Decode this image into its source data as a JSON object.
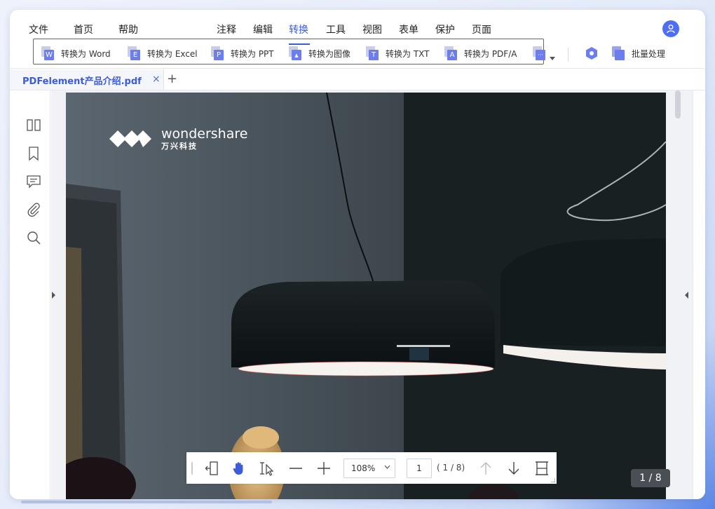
{
  "menubar": {
    "items": [
      "文件",
      "首页",
      "帮助",
      "注释",
      "编辑",
      "转换",
      "工具",
      "视图",
      "表单",
      "保护",
      "页面"
    ],
    "active": "转换"
  },
  "toolbar": {
    "items": [
      {
        "label": "转换为 Word",
        "glyph": "W"
      },
      {
        "label": "转换为 Excel",
        "glyph": "E"
      },
      {
        "label": "转换为 PPT",
        "glyph": "P"
      },
      {
        "label": "转换为图像",
        "glyph": "▲"
      },
      {
        "label": "转换为 TXT",
        "glyph": "T"
      },
      {
        "label": "转换为 PDF/A",
        "glyph": "A"
      }
    ],
    "more_glyph": "···",
    "batch_label": "批量处理"
  },
  "tab": {
    "title": "PDFelement产品介绍.pdf",
    "close": "×",
    "add": "+"
  },
  "sidebar_icons": [
    "panels-icon",
    "bookmark-icon",
    "comment-icon",
    "attachment-icon",
    "search-icon"
  ],
  "document": {
    "logo_text": "wondershare",
    "logo_sub": "万兴科技"
  },
  "bottombar": {
    "zoom": "108%",
    "page_input": "1",
    "page_count": "( 1 / 8)"
  },
  "page_badge": "1 / 8",
  "colors": {
    "accent": "#3d5cd8",
    "highlight_border": "#d8333a",
    "icon_blue": "#6c7df0"
  }
}
